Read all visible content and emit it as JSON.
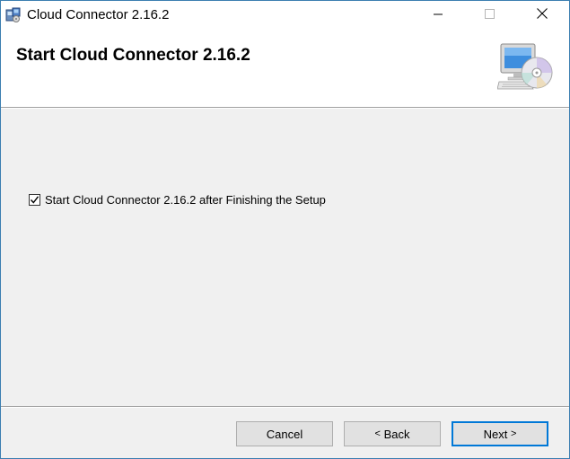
{
  "window": {
    "title": "Cloud Connector 2.16.2",
    "app_icon": "installer-package-icon",
    "controls": {
      "minimize_icon": "minimize-icon",
      "maximize_icon": "maximize-icon",
      "close_icon": "close-icon"
    }
  },
  "banner": {
    "title": "Start Cloud Connector 2.16.2",
    "graphic_icon": "computer-with-disc-icon"
  },
  "options": {
    "start_after_setup": {
      "label": "Start Cloud Connector 2.16.2 after Finishing the Setup",
      "checked": true
    }
  },
  "buttons": {
    "cancel": "Cancel",
    "back": "Back",
    "back_arrow": "<",
    "next": "Next",
    "next_arrow": ">"
  },
  "colors": {
    "accent": "#0078d7",
    "window_border": "#3c7fb1",
    "dialog_bg": "#f0f0f0"
  }
}
